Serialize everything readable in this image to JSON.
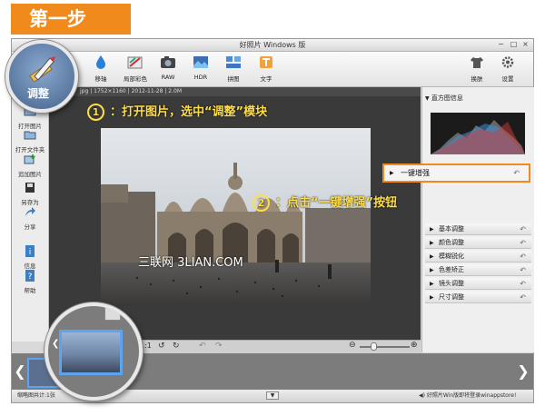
{
  "step_label": "第一步",
  "window": {
    "title": "好照片 Windows 版",
    "controls": [
      "−",
      "□",
      "×"
    ]
  },
  "toolbar": {
    "items": [
      {
        "label": "调整",
        "icon": "pencil-ruler-icon"
      },
      {
        "label": "移轴",
        "icon": "droplet-icon"
      },
      {
        "label": "局部彩色",
        "icon": "brush-color-icon"
      },
      {
        "label": "RAW",
        "icon": "camera-icon"
      },
      {
        "label": "HDR",
        "icon": "hdr-icon"
      },
      {
        "label": "拼图",
        "icon": "collage-icon"
      },
      {
        "label": "文字",
        "icon": "text-icon"
      }
    ],
    "right_items": [
      {
        "label": "换肤",
        "icon": "shirt-icon"
      },
      {
        "label": "设置",
        "icon": "gear-icon"
      }
    ]
  },
  "sidebar": {
    "items": [
      {
        "label": "打开图片",
        "icon": "open-image-icon"
      },
      {
        "label": "打开文件夹",
        "icon": "folder-icon"
      },
      {
        "label": "追加图片",
        "icon": "add-image-icon"
      },
      {
        "label": "另存为",
        "icon": "save-icon"
      },
      {
        "label": "分享",
        "icon": "share-icon"
      },
      {
        "label": "信息",
        "icon": "info-icon"
      },
      {
        "label": "帮助",
        "icon": "help-icon"
      }
    ]
  },
  "image_info": {
    "type": "jpg",
    "dimensions": "1752×1160",
    "date": "2012-11-28",
    "size": "2.0M"
  },
  "zoom": {
    "ratio": "1:1"
  },
  "right_panel": {
    "histogram_title": "直方图信息",
    "enhance_label": "一键增强",
    "items": [
      "基本调整",
      "颜色调整",
      "模糊锐化",
      "色差矫正",
      "镜头调整",
      "尺寸调整"
    ]
  },
  "annotations": {
    "step1_num": "1",
    "step1_text": "：打开图片，选中“调整”模块",
    "step2_num": "2",
    "step2_text": "：点击“一键增强”按钮",
    "watermark": "三联网 3LIAN.COM"
  },
  "status": {
    "left": "缩略图共计:1张",
    "right": "好照片Win版即将登录winappstore!"
  },
  "colors": {
    "accent": "#f08a1c",
    "annotation": "#ffdd44"
  }
}
